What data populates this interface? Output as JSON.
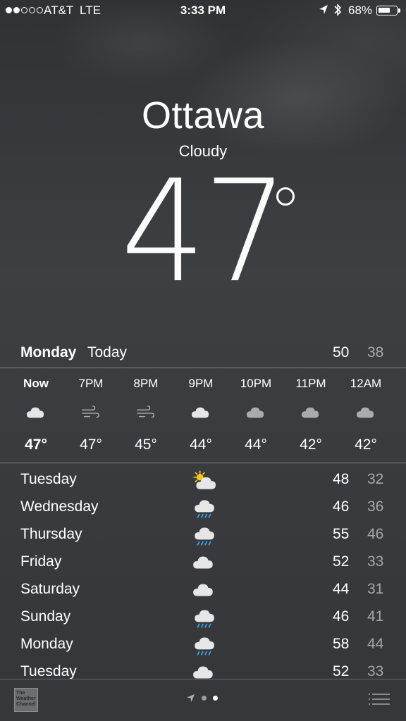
{
  "status_bar": {
    "signal_dots": [
      true,
      true,
      false,
      false,
      false
    ],
    "carrier": "AT&T",
    "network": "LTE",
    "time": "3:33 PM",
    "location_icon": "location-arrow-icon",
    "bluetooth_icon": "bluetooth-icon",
    "battery_percent": "68%",
    "battery_level": 0.68
  },
  "current": {
    "city": "Ottawa",
    "condition": "Cloudy",
    "temperature": "47"
  },
  "today": {
    "day": "Monday",
    "label": "Today",
    "high": "50",
    "low": "38"
  },
  "hourly": [
    {
      "time": "Now",
      "icon": "cloud-icon",
      "temp": "47°"
    },
    {
      "time": "7PM",
      "icon": "wind-icon",
      "temp": "47°"
    },
    {
      "time": "8PM",
      "icon": "wind-icon",
      "temp": "45°"
    },
    {
      "time": "9PM",
      "icon": "cloud-icon",
      "temp": "44°"
    },
    {
      "time": "10PM",
      "icon": "cloud-night-icon",
      "temp": "44°"
    },
    {
      "time": "11PM",
      "icon": "cloud-night-icon",
      "temp": "42°"
    },
    {
      "time": "12AM",
      "icon": "cloud-night-icon",
      "temp": "42°"
    }
  ],
  "daily": [
    {
      "day": "Tuesday",
      "icon": "partly-sunny-icon",
      "high": "48",
      "low": "32"
    },
    {
      "day": "Wednesday",
      "icon": "rain-cloud-icon",
      "high": "46",
      "low": "36"
    },
    {
      "day": "Thursday",
      "icon": "rain-cloud-icon",
      "high": "55",
      "low": "46"
    },
    {
      "day": "Friday",
      "icon": "cloud-icon",
      "high": "52",
      "low": "33"
    },
    {
      "day": "Saturday",
      "icon": "cloud-icon",
      "high": "44",
      "low": "31"
    },
    {
      "day": "Sunday",
      "icon": "rain-cloud-icon",
      "high": "46",
      "low": "41"
    },
    {
      "day": "Monday",
      "icon": "rain-cloud-icon",
      "high": "58",
      "low": "44"
    },
    {
      "day": "Tuesday",
      "icon": "cloud-icon",
      "high": "52",
      "low": "33"
    }
  ],
  "bottom_bar": {
    "logo_text": [
      "The",
      "Weather",
      "Channel"
    ],
    "pager_icon": "location-arrow-icon",
    "pages": 2,
    "active_page": 1,
    "list_icon": "list-icon"
  },
  "colors": {
    "background": "#3a3c3f",
    "cloud_day": "#e6e6e6",
    "cloud_night": "#a9abae",
    "rain": "#3ba7e6",
    "sun": "#f5c518"
  }
}
